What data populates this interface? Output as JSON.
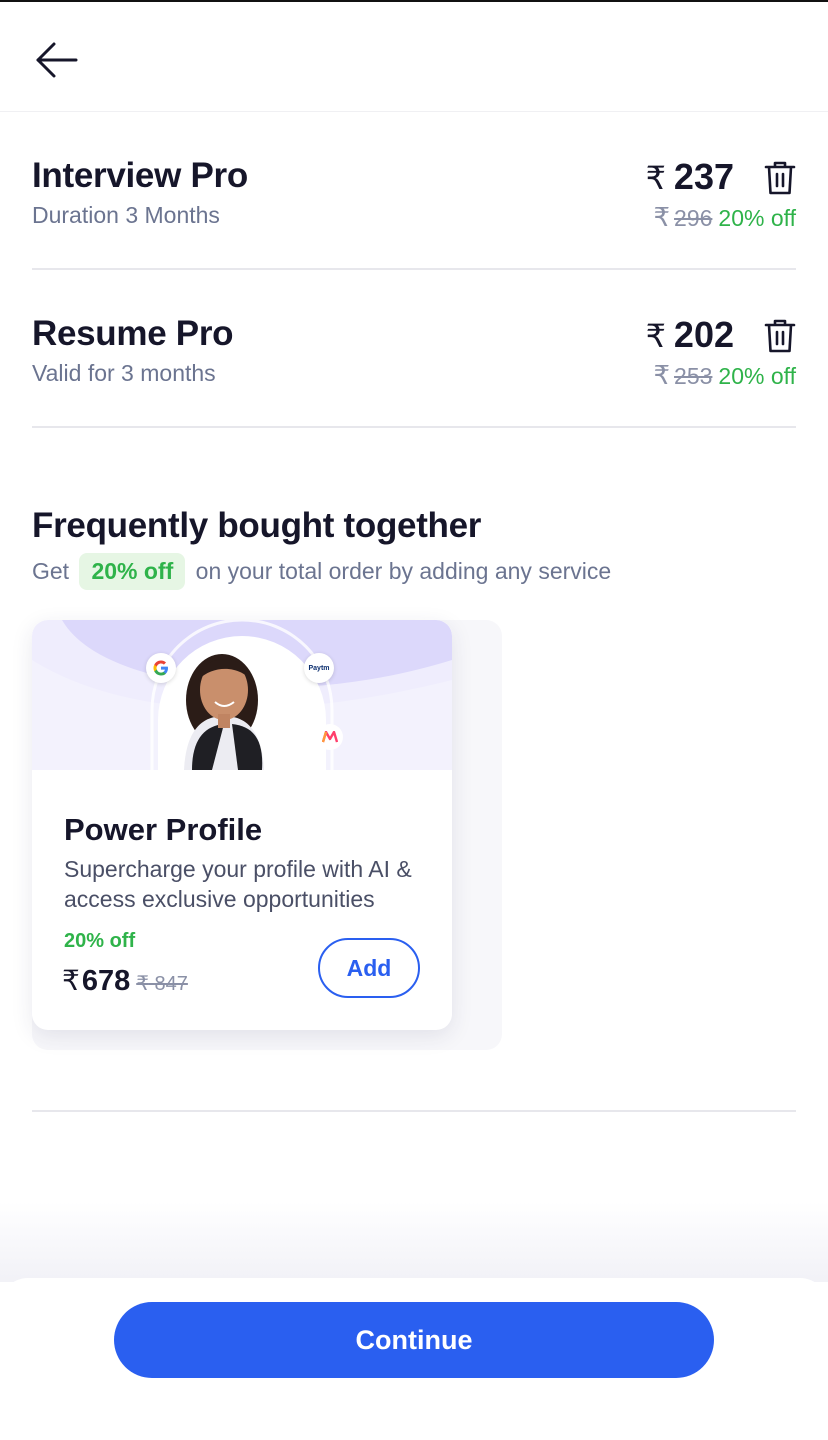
{
  "header": {
    "back_icon": "arrow-left-icon"
  },
  "cart": {
    "items": [
      {
        "title": "Interview Pro",
        "subtitle": "Duration 3 Months",
        "currency": "₹",
        "price": "237",
        "original_price": "296",
        "discount": "20% off",
        "delete_icon": "trash-icon"
      },
      {
        "title": "Resume Pro",
        "subtitle": "Valid for 3 months",
        "currency": "₹",
        "price": "202",
        "original_price": "253",
        "discount": "20% off",
        "delete_icon": "trash-icon"
      }
    ]
  },
  "fbt": {
    "title": "Frequently bought together",
    "sub_prefix": "Get",
    "sub_pill": "20% off",
    "sub_suffix": "on your total order by adding any service",
    "card": {
      "title": "Power Profile",
      "description": "Supercharge your profile with AI & access exclusive opportunities",
      "discount": "20% off",
      "currency": "₹",
      "price": "678",
      "original_price": "847",
      "add_label": "Add",
      "brand_icons": [
        "google-logo-icon",
        "paytm-logo-icon",
        "myntra-logo-icon"
      ],
      "paytm_text": "Paytm"
    }
  },
  "footer": {
    "continue_label": "Continue"
  },
  "colors": {
    "accent": "#2a5ff0",
    "discount_green": "#2fb34a",
    "text_dark": "#16162a",
    "text_muted": "#6b7490"
  }
}
